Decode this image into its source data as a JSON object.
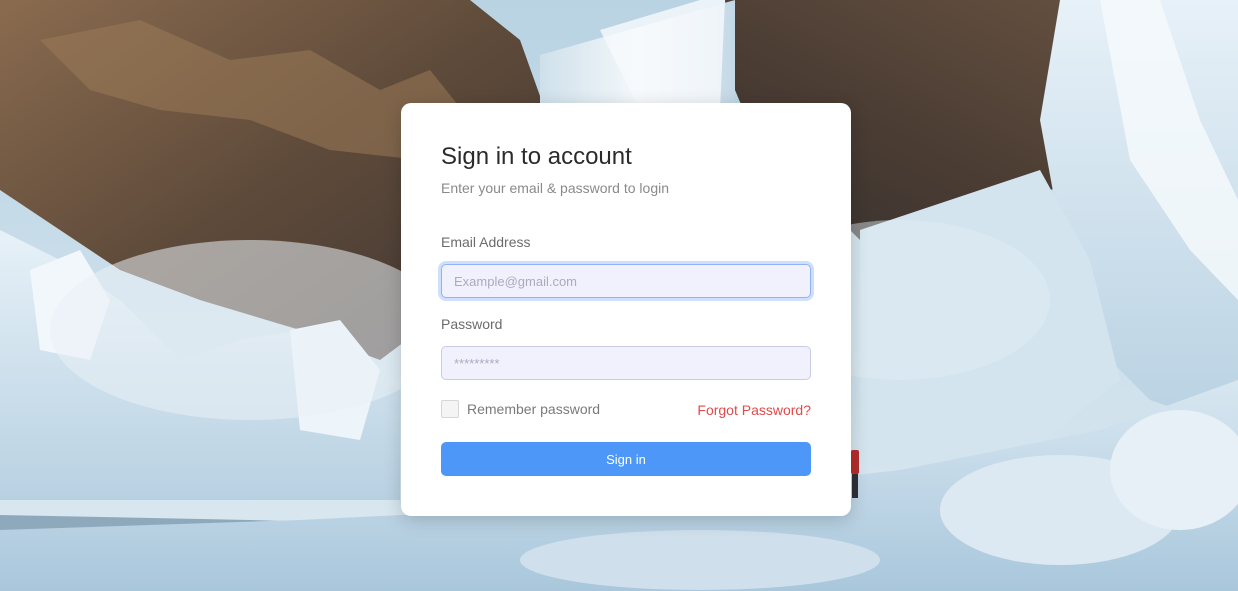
{
  "login": {
    "title": "Sign in to account",
    "subtitle": "Enter your email & password to login",
    "email_label": "Email Address",
    "email_placeholder": "Example@gmail.com",
    "password_label": "Password",
    "password_placeholder": "*********",
    "remember_label": "Remember password",
    "forgot_label": "Forgot Password?",
    "signin_label": "Sign in"
  },
  "colors": {
    "primary_button": "#4c97f7",
    "forgot_link": "#e04b4b",
    "input_background": "#f0f1fd"
  }
}
